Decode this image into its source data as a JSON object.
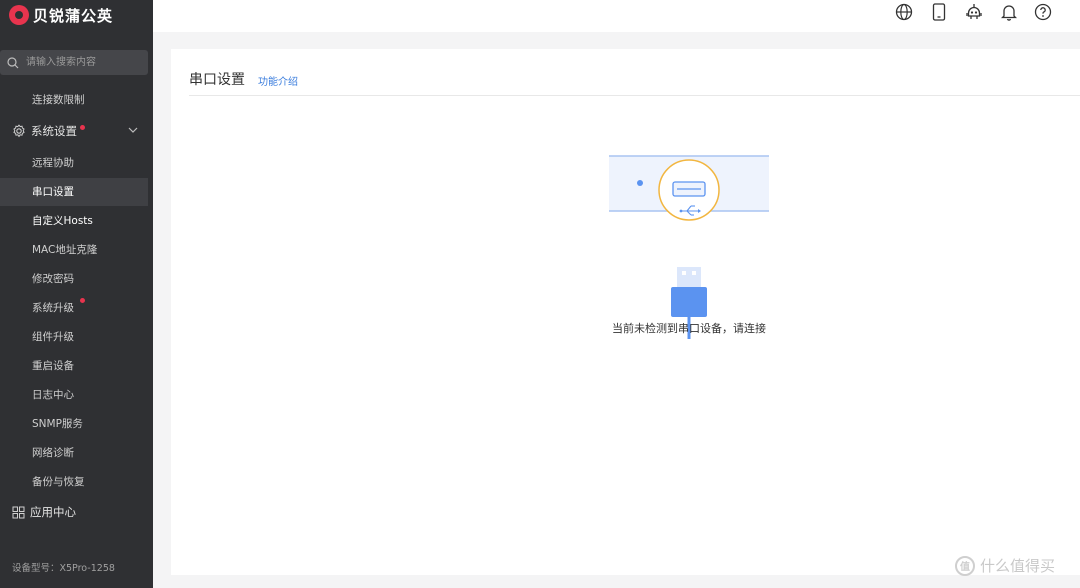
{
  "app": {
    "brand": "贝锐蒲公英"
  },
  "sidebar": {
    "search_placeholder": "请输入搜索内容",
    "items": [
      {
        "label": "连接数限制"
      },
      {
        "label": "系统设置",
        "group": true,
        "badge": true
      },
      {
        "label": "远程协助"
      },
      {
        "label": "串口设置",
        "active": true
      },
      {
        "label": "自定义Hosts"
      },
      {
        "label": "MAC地址克隆"
      },
      {
        "label": "修改密码"
      },
      {
        "label": "系统升级",
        "badge": true
      },
      {
        "label": "组件升级"
      },
      {
        "label": "重启设备"
      },
      {
        "label": "日志中心"
      },
      {
        "label": "SNMP服务"
      },
      {
        "label": "网络诊断"
      },
      {
        "label": "备份与恢复"
      },
      {
        "label": "应用中心",
        "group": true
      }
    ],
    "model": "设备型号：X5Pro-1258"
  },
  "topbar": {
    "icons": [
      "globe-icon",
      "mobile-icon",
      "robot-icon",
      "bell-icon",
      "help-icon"
    ]
  },
  "page": {
    "title": "串口设置",
    "help_link": "功能介绍",
    "empty_message": "当前未检测到串口设备，请连接"
  },
  "watermark": {
    "badge": "值",
    "text": "什么值得买"
  },
  "colors": {
    "accent": "#3b7ddd",
    "brand": "#e8344e",
    "sidebar_bg": "#2f3033",
    "usb_blue": "#5b93f0",
    "ring_orange": "#f2b640"
  }
}
